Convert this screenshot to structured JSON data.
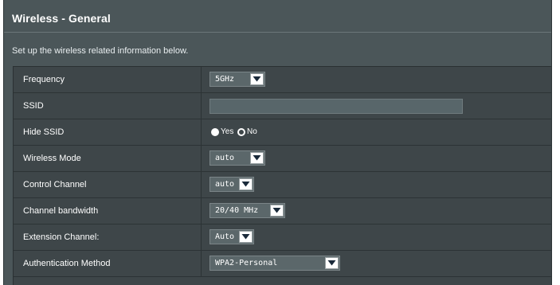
{
  "page": {
    "title": "Wireless - General",
    "description": "Set up the wireless related information below."
  },
  "fields": {
    "frequency": {
      "label": "Frequency",
      "value": "5GHz"
    },
    "ssid": {
      "label": "SSID",
      "value": ""
    },
    "hide_ssid": {
      "label": "Hide SSID",
      "yes_label": "Yes",
      "no_label": "No",
      "selected": "Yes"
    },
    "wireless_mode": {
      "label": "Wireless Mode",
      "value": "auto"
    },
    "control_channel": {
      "label": "Control Channel",
      "value": "auto"
    },
    "channel_bandwidth": {
      "label": "Channel bandwidth",
      "value": "20/40 MHz"
    },
    "extension_channel": {
      "label": "Extension Channel:",
      "value": "Auto"
    },
    "authentication_method": {
      "label": "Authentication Method",
      "value": "WPA2-Personal"
    }
  },
  "icons": {
    "dropdown": "chevron-down-icon"
  },
  "colors": {
    "panel": "#4b5659",
    "table": "#3e4649",
    "text": "#ffffff"
  }
}
